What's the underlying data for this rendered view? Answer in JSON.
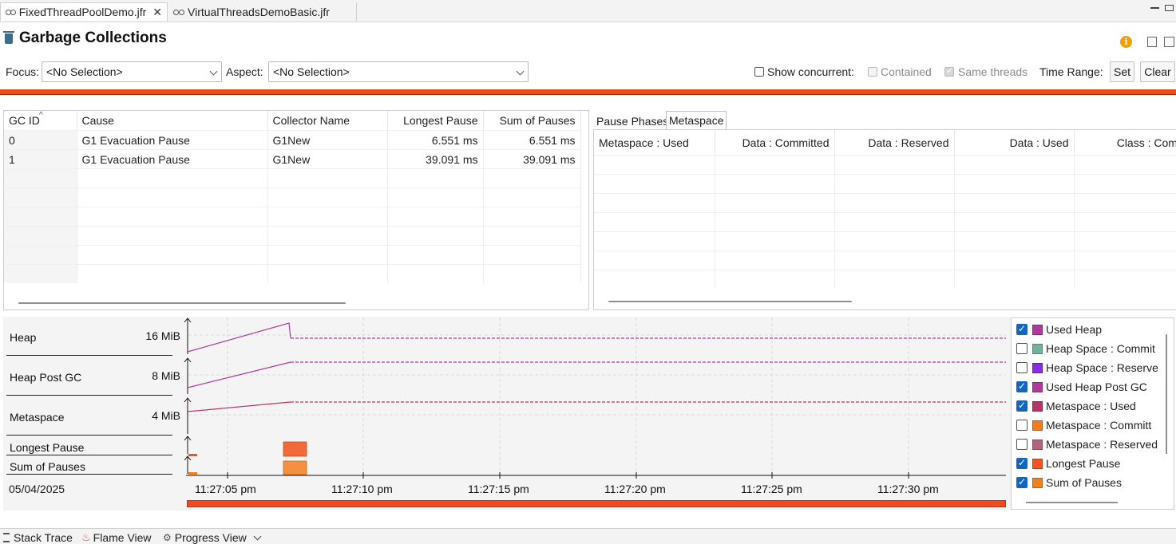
{
  "editor_tabs": [
    {
      "label": "FixedThreadPoolDemo.jfr",
      "active": true
    },
    {
      "label": "VirtualThreadsDemoBasic.jfr",
      "active": false
    }
  ],
  "page": {
    "title": "Garbage Collections"
  },
  "toolbar": {
    "focus_label": "Focus:",
    "focus_value": "<No Selection>",
    "aspect_label": "Aspect:",
    "aspect_value": "<No Selection>",
    "show_concurrent_label": "Show concurrent:",
    "contained_label": "Contained",
    "same_threads_label": "Same threads",
    "time_range_label": "Time Range:",
    "set_label": "Set",
    "clear_label": "Clear"
  },
  "gc_table": {
    "columns": [
      "GC ID",
      "Cause",
      "Collector Name",
      "Longest Pause",
      "Sum of Pauses"
    ],
    "rows": [
      [
        "0",
        "G1 Evacuation Pause",
        "G1New",
        "6.551 ms",
        "6.551 ms"
      ],
      [
        "1",
        "G1 Evacuation Pause",
        "G1New",
        "39.091 ms",
        "39.091 ms"
      ]
    ]
  },
  "detail_tabs": [
    "Pause Phases",
    "Metaspace"
  ],
  "metaspace_table": {
    "columns": [
      "Metaspace : Used",
      "Data : Committed",
      "Data : Reserved",
      "Data : Used",
      "Class : Committ"
    ]
  },
  "chart_rows": [
    {
      "label": "Heap",
      "max": "16 MiB"
    },
    {
      "label": "Heap Post GC",
      "max": "8 MiB"
    },
    {
      "label": "Metaspace",
      "max": "4 MiB"
    },
    {
      "label": "Longest Pause",
      "max": ""
    },
    {
      "label": "Sum of Pauses",
      "max": ""
    }
  ],
  "chart_date": "05/04/2025",
  "time_ticks": [
    "11:27:05 pm",
    "11:27:10 pm",
    "11:27:15 pm",
    "11:27:20 pm",
    "11:27:25 pm",
    "11:27:30 pm"
  ],
  "legend": [
    {
      "label": "Used Heap",
      "checked": true,
      "color": "#b0399f"
    },
    {
      "label": "Heap Space : Commit",
      "checked": false,
      "color": "#6fb49a"
    },
    {
      "label": "Heap Space : Reserve",
      "checked": false,
      "color": "#8a2be2"
    },
    {
      "label": "Used Heap Post GC",
      "checked": true,
      "color": "#b0399f"
    },
    {
      "label": "Metaspace : Used",
      "checked": true,
      "color": "#b8336a"
    },
    {
      "label": "Metaspace : Committ",
      "checked": false,
      "color": "#f07d1e"
    },
    {
      "label": "Metaspace : Reserved",
      "checked": false,
      "color": "#b0657a"
    },
    {
      "label": "Longest Pause",
      "checked": true,
      "color": "#f2541d"
    },
    {
      "label": "Sum of Pauses",
      "checked": true,
      "color": "#f0801e"
    }
  ],
  "bottom_tabs": [
    "Stack Trace",
    "Flame View",
    "Progress View"
  ],
  "colors": {
    "accent_orange": "#e84e1c",
    "heap_line": "#b0399f"
  }
}
